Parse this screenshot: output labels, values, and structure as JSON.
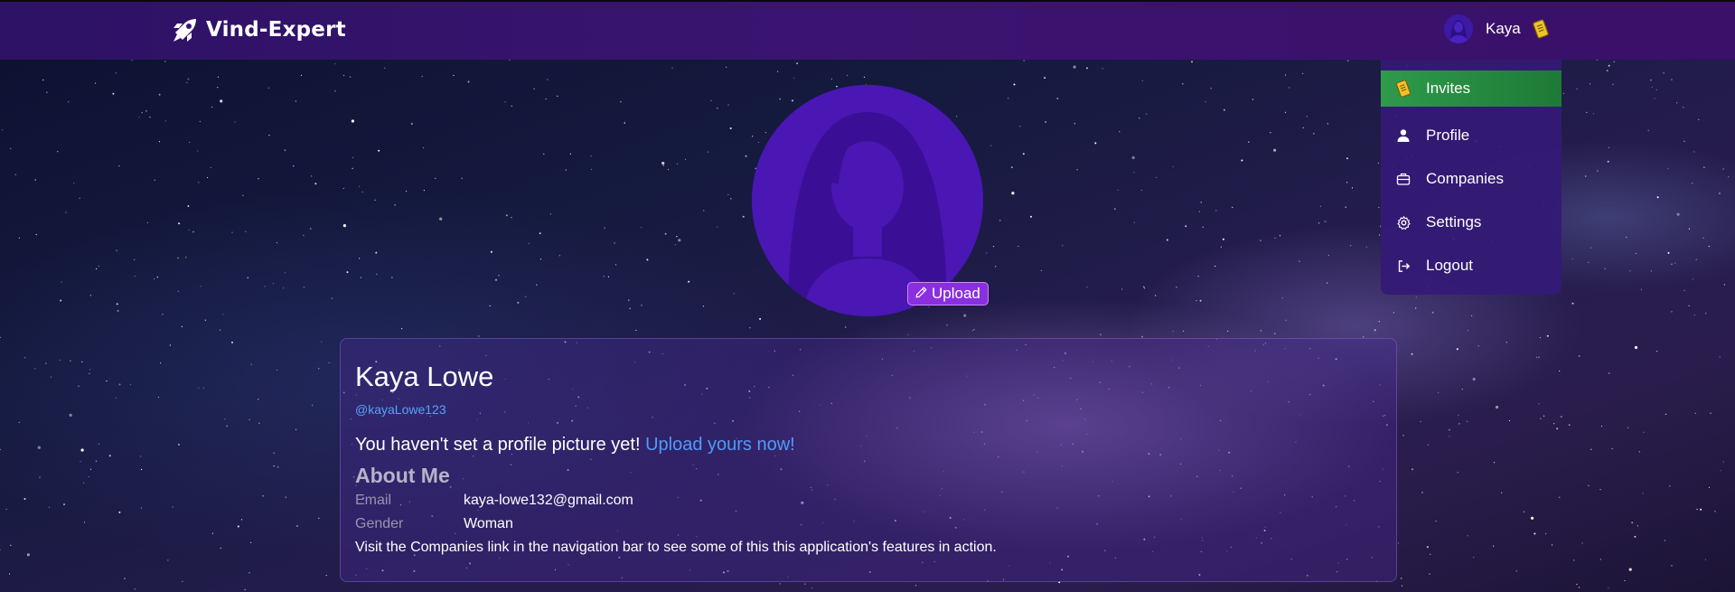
{
  "app": {
    "brand_name": "Vind-Expert",
    "brand_icon": "rocket-icon"
  },
  "topbar": {
    "user_name": "Kaya",
    "user_avatar": "user-avatar",
    "badge_icon": "invite-notification-icon",
    "colors": {
      "bar": "#3b1471",
      "accent": "#8a2fe0"
    }
  },
  "dropdown": {
    "items": [
      {
        "label": "Invites",
        "icon": "invite-icon",
        "active": true
      },
      {
        "label": "Profile",
        "icon": "person-icon"
      },
      {
        "label": "Companies",
        "icon": "briefcase-icon"
      },
      {
        "label": "Settings",
        "icon": "gear-icon"
      },
      {
        "label": "Logout",
        "icon": "logout-icon"
      }
    ],
    "active_color": "#2e9b4b"
  },
  "profile": {
    "upload_label": "Upload",
    "full_name": "Kaya Lowe",
    "handle": "@kayaLowe123",
    "no_picture_message": "You haven't set a profile picture yet!",
    "upload_link_label": "Upload yours now!",
    "about_heading": "About Me",
    "fields": [
      {
        "label": "Email",
        "value": "kaya-lowe132@gmail.com"
      },
      {
        "label": "Gender",
        "value": "Woman"
      }
    ],
    "note": "Visit the Companies link in the navigation bar to see some of this this application's features in action."
  }
}
